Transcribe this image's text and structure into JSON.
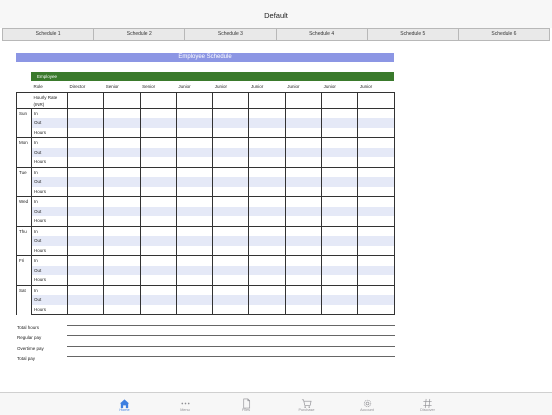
{
  "app": {
    "title": "Default"
  },
  "tabs": [
    "Schedule 1",
    "Schedule 2",
    "Schedule 3",
    "Schedule 4",
    "Schedule 5",
    "Schedule 6"
  ],
  "sheet": {
    "title": "Employee Schedule",
    "employee_label": "Employee",
    "role_label": "Role",
    "roles": [
      "Director",
      "Senior",
      "Senior",
      "Junior",
      "Junior",
      "Junior",
      "Junior",
      "Junior",
      "Junior"
    ],
    "hourly_rate_label": "Hourly Rate (INR)",
    "days": [
      "Sun",
      "Mon",
      "Tue",
      "Wed",
      "Thu",
      "Fri",
      "Sat"
    ],
    "sub_rows": [
      "In",
      "Out",
      "Hours"
    ],
    "totals": [
      "Total hours",
      "Regular pay",
      "Overtime pay",
      "Total pay"
    ]
  },
  "bottom_nav": [
    {
      "label": "Home",
      "icon": "home-icon",
      "active": true
    },
    {
      "label": "Menu",
      "icon": "more-icon",
      "active": false
    },
    {
      "label": "Files",
      "icon": "file-icon",
      "active": false
    },
    {
      "label": "Purchase",
      "icon": "cart-icon",
      "active": false
    },
    {
      "label": "Account",
      "icon": "gear-icon",
      "active": false
    },
    {
      "label": "Discover",
      "icon": "hash-icon",
      "active": false
    }
  ],
  "colors": {
    "header_blue": "#8c96e4",
    "employee_green": "#3a7a2c",
    "row_shade": "#e5e9f7",
    "nav_active": "#3d7fe0"
  }
}
